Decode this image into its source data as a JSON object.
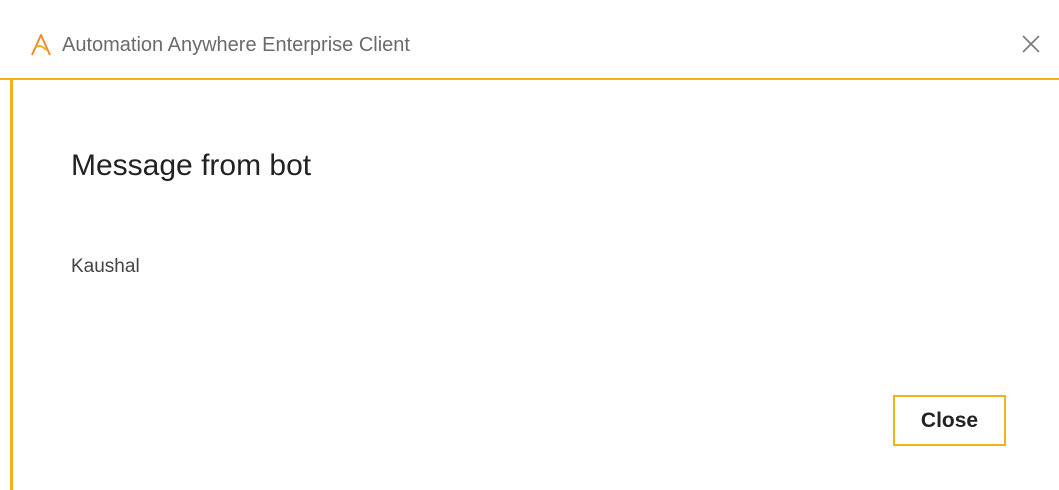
{
  "window": {
    "title": "Automation Anywhere Enterprise Client",
    "logo_icon": "automation-anywhere-logo-icon",
    "close_icon": "close-icon",
    "accent_color": "#f2b21a"
  },
  "dialog": {
    "heading": "Message from bot",
    "message": "Kaushal",
    "close_label": "Close"
  }
}
